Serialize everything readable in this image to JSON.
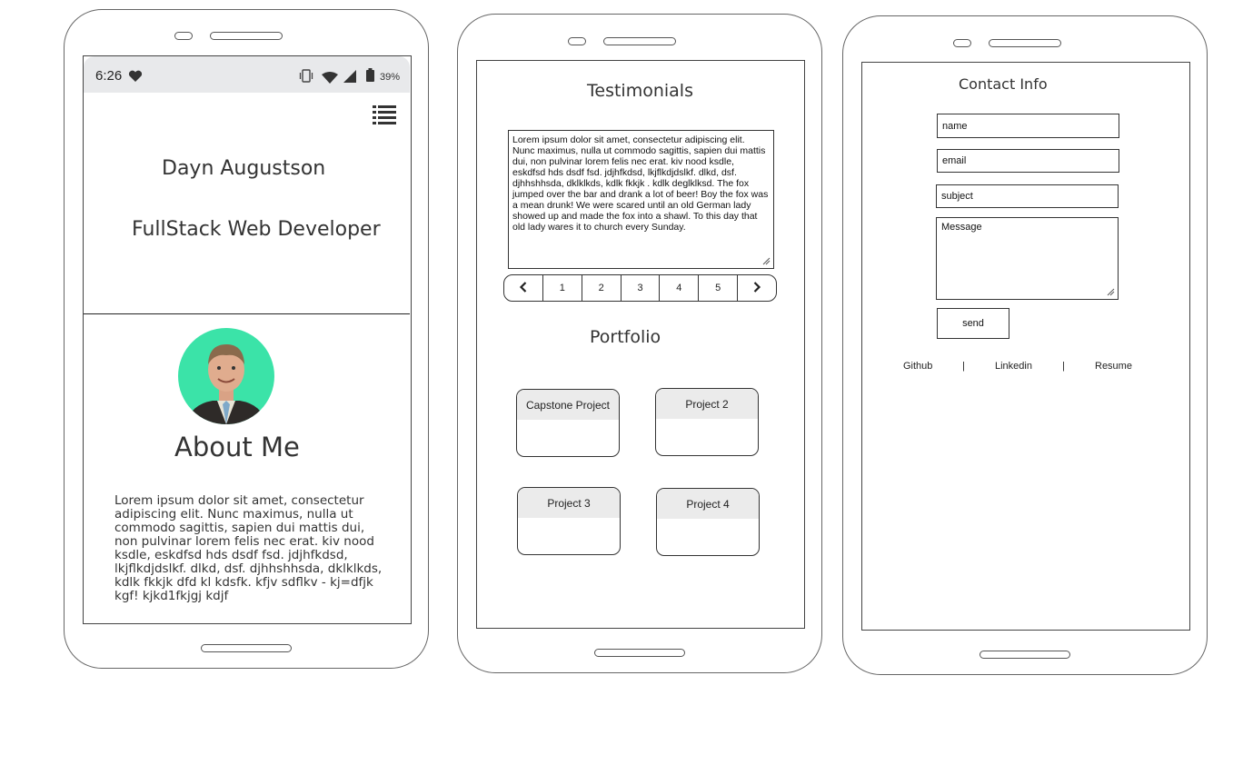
{
  "profile": {
    "status_bar": {
      "time": "6:26",
      "battery": "39%"
    },
    "name": "Dayn Augustson",
    "job_title": "FullStack Web Developer",
    "about_title": "About Me",
    "about_text": "Lorem ipsum dolor sit amet, consectetur adipiscing elit. Nunc maximus, nulla ut commodo sagittis, sapien dui mattis dui, non pulvinar lorem felis nec erat. kiv nood ksdle, eskdfsd hds dsdf fsd. jdjhfkdsd, lkjflkdjdslkf. dlkd, dsf. djhhshhsda, dklklkds, kdlk fkkjk dfd kl kdsfk. kfjv  sdflkv - kj=dfjk kgf! kjkd1fkjgj kdjf"
  },
  "testimonials": {
    "title": "Testimonials",
    "text": "Lorem ipsum dolor sit amet, consectetur adipiscing elit. Nunc maximus, nulla ut commodo sagittis, sapien dui mattis dui, non pulvinar lorem felis nec erat. kiv nood ksdle, eskdfsd hds dsdf fsd. jdjhfkdsd, lkjflkdjdslkf. dlkd, dsf. djhhshhsda, dklklkds, kdlk fkkjk . kdlk deglklksd. The fox jumped over the bar and drank a lot of beer! Boy the fox was a mean drunk! We were scared until an old German lady showed up and made the fox into a shawl. To this day that old lady  wares it to church every Sunday.",
    "pages": [
      "1",
      "2",
      "3",
      "4",
      "5"
    ]
  },
  "portfolio": {
    "title": "Portfolio",
    "projects": [
      "Capstone Project",
      "Project 2",
      "Project 3",
      "Project 4"
    ]
  },
  "contact": {
    "title": "Contact Info",
    "name_placeholder": "name",
    "email_placeholder": "email",
    "subject_placeholder": "subject",
    "message_placeholder": "Message",
    "send_label": "send",
    "links": [
      "Github",
      "Linkedin",
      "Resume"
    ],
    "separator": "|"
  },
  "icons": {
    "menu": "list-icon",
    "heart": "heart-icon",
    "vibrate": "vibrate-icon",
    "wifi": "wifi-icon",
    "signal": "signal-icon",
    "battery": "battery-icon",
    "prev": "chevron-left-icon",
    "next": "chevron-right-icon"
  },
  "colors": {
    "avatar_bg": "#3be3a8",
    "status_bar": "#e8e9eb",
    "card_header": "#ebebeb"
  }
}
